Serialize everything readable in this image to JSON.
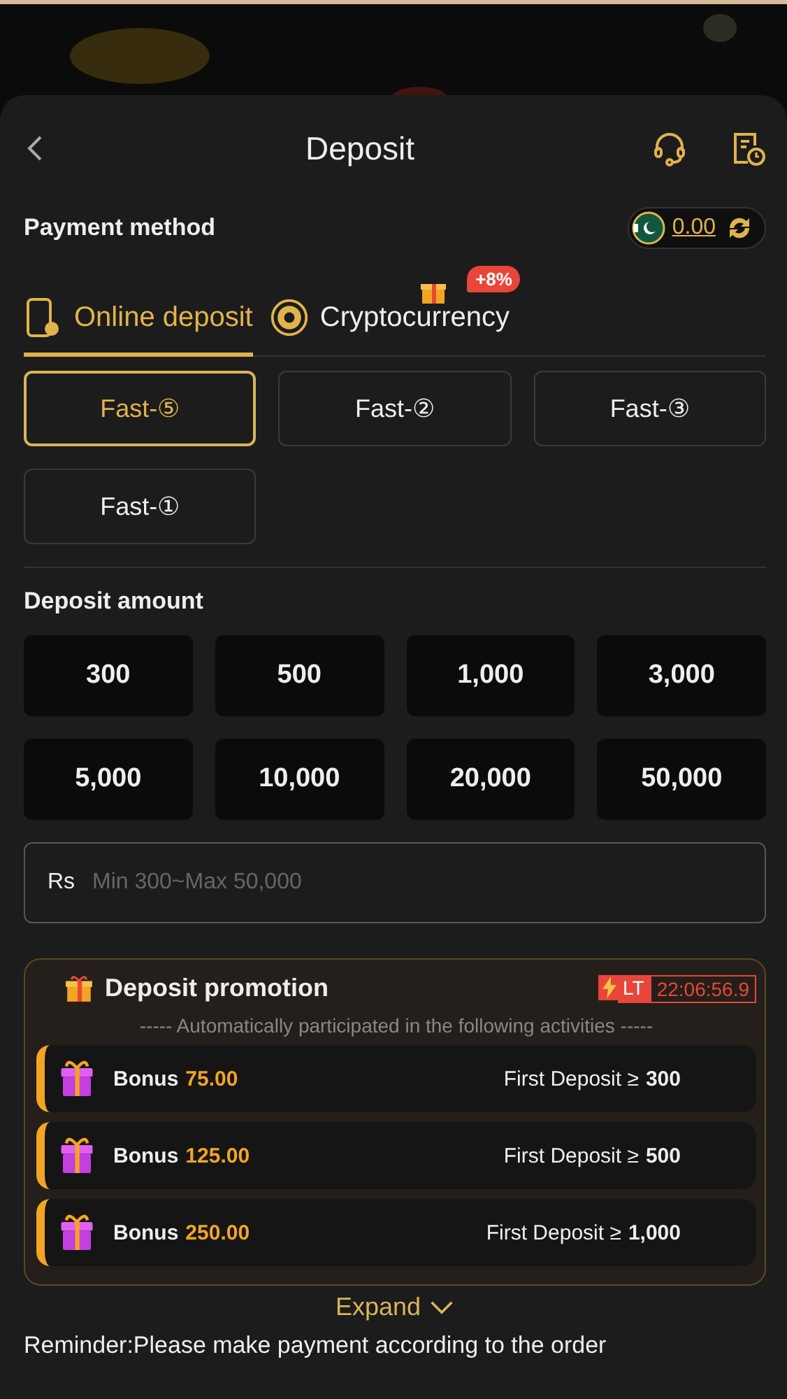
{
  "header": {
    "title": "Deposit"
  },
  "payment": {
    "label": "Payment method",
    "balance": "0.00"
  },
  "tabs": [
    {
      "label": "Online deposit",
      "selected": true,
      "kind": "phone"
    },
    {
      "label": "Cryptocurrency",
      "selected": false,
      "kind": "coin",
      "badge": "+8%"
    }
  ],
  "channels": [
    {
      "label": "Fast-⑤",
      "selected": true
    },
    {
      "label": "Fast-②",
      "selected": false
    },
    {
      "label": "Fast-③",
      "selected": false
    },
    {
      "label": "Fast-①",
      "selected": false
    }
  ],
  "amount": {
    "label": "Deposit amount",
    "options": [
      "300",
      "500",
      "1,000",
      "3,000",
      "5,000",
      "10,000",
      "20,000",
      "50,000"
    ],
    "currency": "Rs",
    "placeholder": "Min 300~Max 50,000"
  },
  "promotion": {
    "title": "Deposit promotion",
    "timer_tag": "LT",
    "timer": "22:06:56.9",
    "subtitle": "----- Automatically participated in the following activities -----",
    "items": [
      {
        "label": "Bonus",
        "amount": "75.00",
        "condition": "First Deposit ≥",
        "threshold": "300"
      },
      {
        "label": "Bonus",
        "amount": "125.00",
        "condition": "First Deposit ≥",
        "threshold": "500"
      },
      {
        "label": "Bonus",
        "amount": "250.00",
        "condition": "First Deposit ≥",
        "threshold": "1,000"
      }
    ]
  },
  "expand": "Expand",
  "reminder": "Reminder:Please make payment according to the order"
}
